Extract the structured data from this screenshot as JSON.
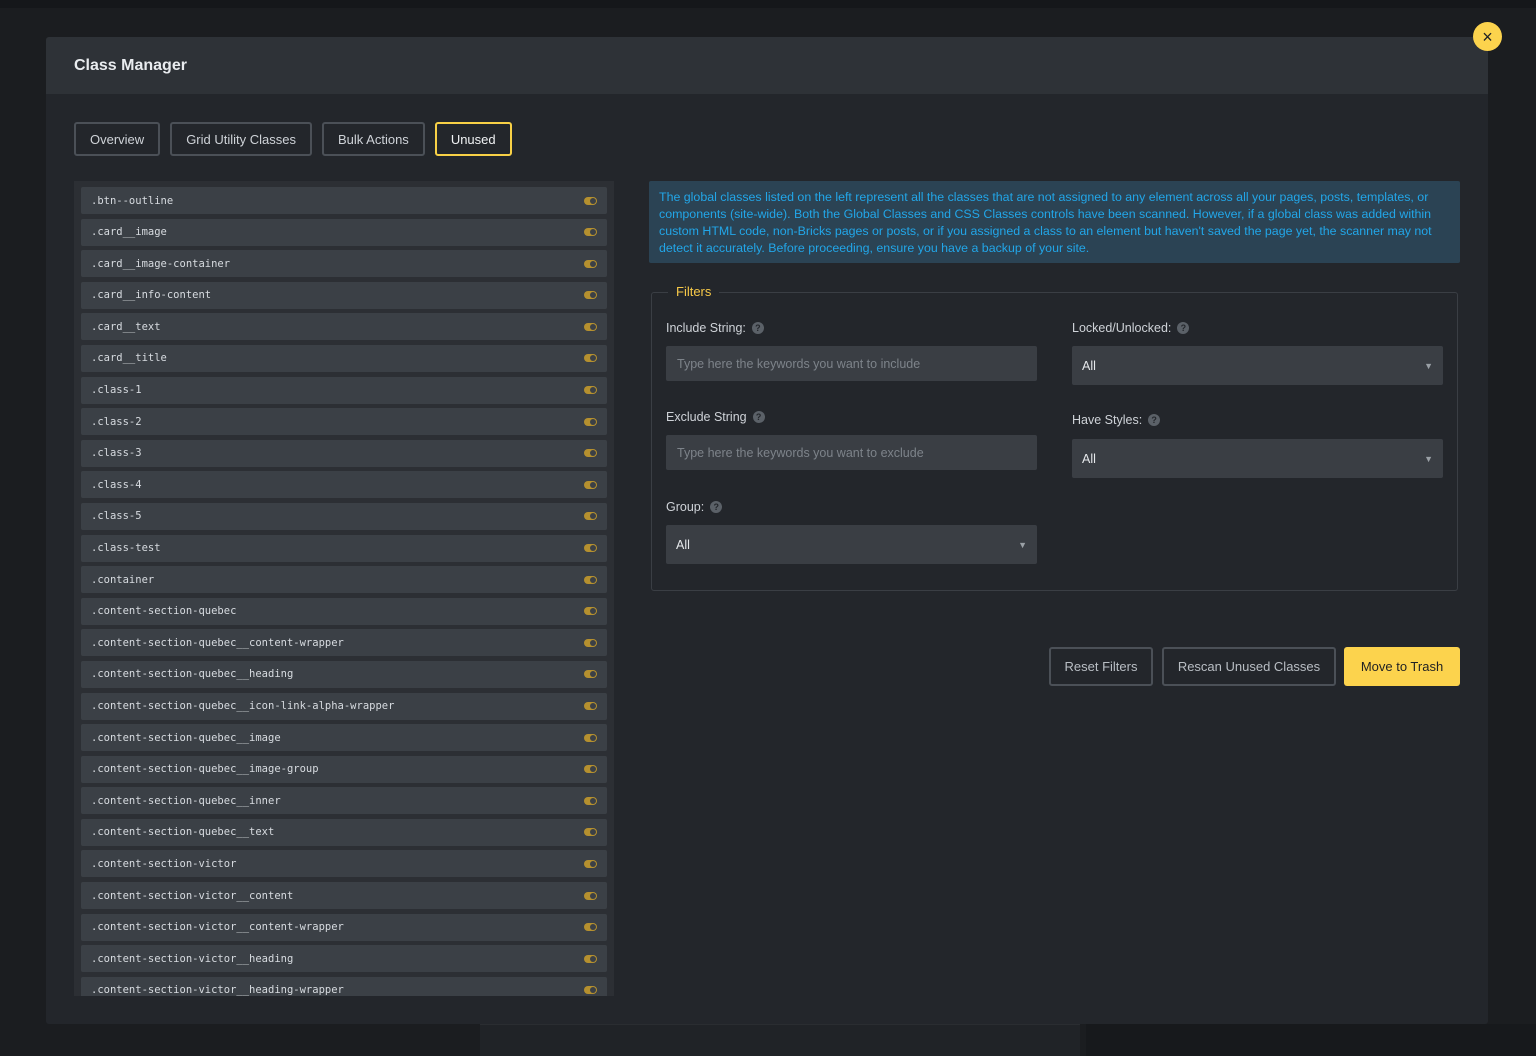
{
  "modal": {
    "title": "Class Manager",
    "close_icon": "×"
  },
  "tabs": [
    {
      "label": "Overview",
      "active": false
    },
    {
      "label": "Grid Utility Classes",
      "active": false
    },
    {
      "label": "Bulk Actions",
      "active": false
    },
    {
      "label": "Unused",
      "active": true
    }
  ],
  "classes": [
    ".btn--outline",
    ".card__image",
    ".card__image-container",
    ".card__info-content",
    ".card__text",
    ".card__title",
    ".class-1",
    ".class-2",
    ".class-3",
    ".class-4",
    ".class-5",
    ".class-test",
    ".container",
    ".content-section-quebec",
    ".content-section-quebec__content-wrapper",
    ".content-section-quebec__heading",
    ".content-section-quebec__icon-link-alpha-wrapper",
    ".content-section-quebec__image",
    ".content-section-quebec__image-group",
    ".content-section-quebec__inner",
    ".content-section-quebec__text",
    ".content-section-victor",
    ".content-section-victor__content",
    ".content-section-victor__content-wrapper",
    ".content-section-victor__heading",
    ".content-section-victor__heading-wrapper"
  ],
  "notice": "The global classes listed on the left represent all the classes that are not assigned to any element across all your pages, posts, templates, or components (site-wide). Both the Global Classes and CSS Classes controls have been scanned. However, if a global class was added within custom HTML code, non-Bricks pages or posts, or if you assigned a class to an element but haven't saved the page yet, the scanner may not detect it accurately. Before proceeding, ensure you have a backup of your site.",
  "filters": {
    "legend": "Filters",
    "include_label": "Include String:",
    "include_placeholder": "Type here the keywords you want to include",
    "exclude_label": "Exclude String",
    "exclude_placeholder": "Type here the keywords you want to exclude",
    "group_label": "Group:",
    "group_value": "All",
    "locked_label": "Locked/Unlocked:",
    "locked_value": "All",
    "styles_label": "Have Styles:",
    "styles_value": "All",
    "help_icon": "?"
  },
  "actions": {
    "reset": "Reset Filters",
    "rescan": "Rescan Unused Classes",
    "trash": "Move to Trash"
  },
  "colors": {
    "accent": "#fcd34d",
    "notice_text": "#22a6e8",
    "toggle": "#b5902f"
  }
}
